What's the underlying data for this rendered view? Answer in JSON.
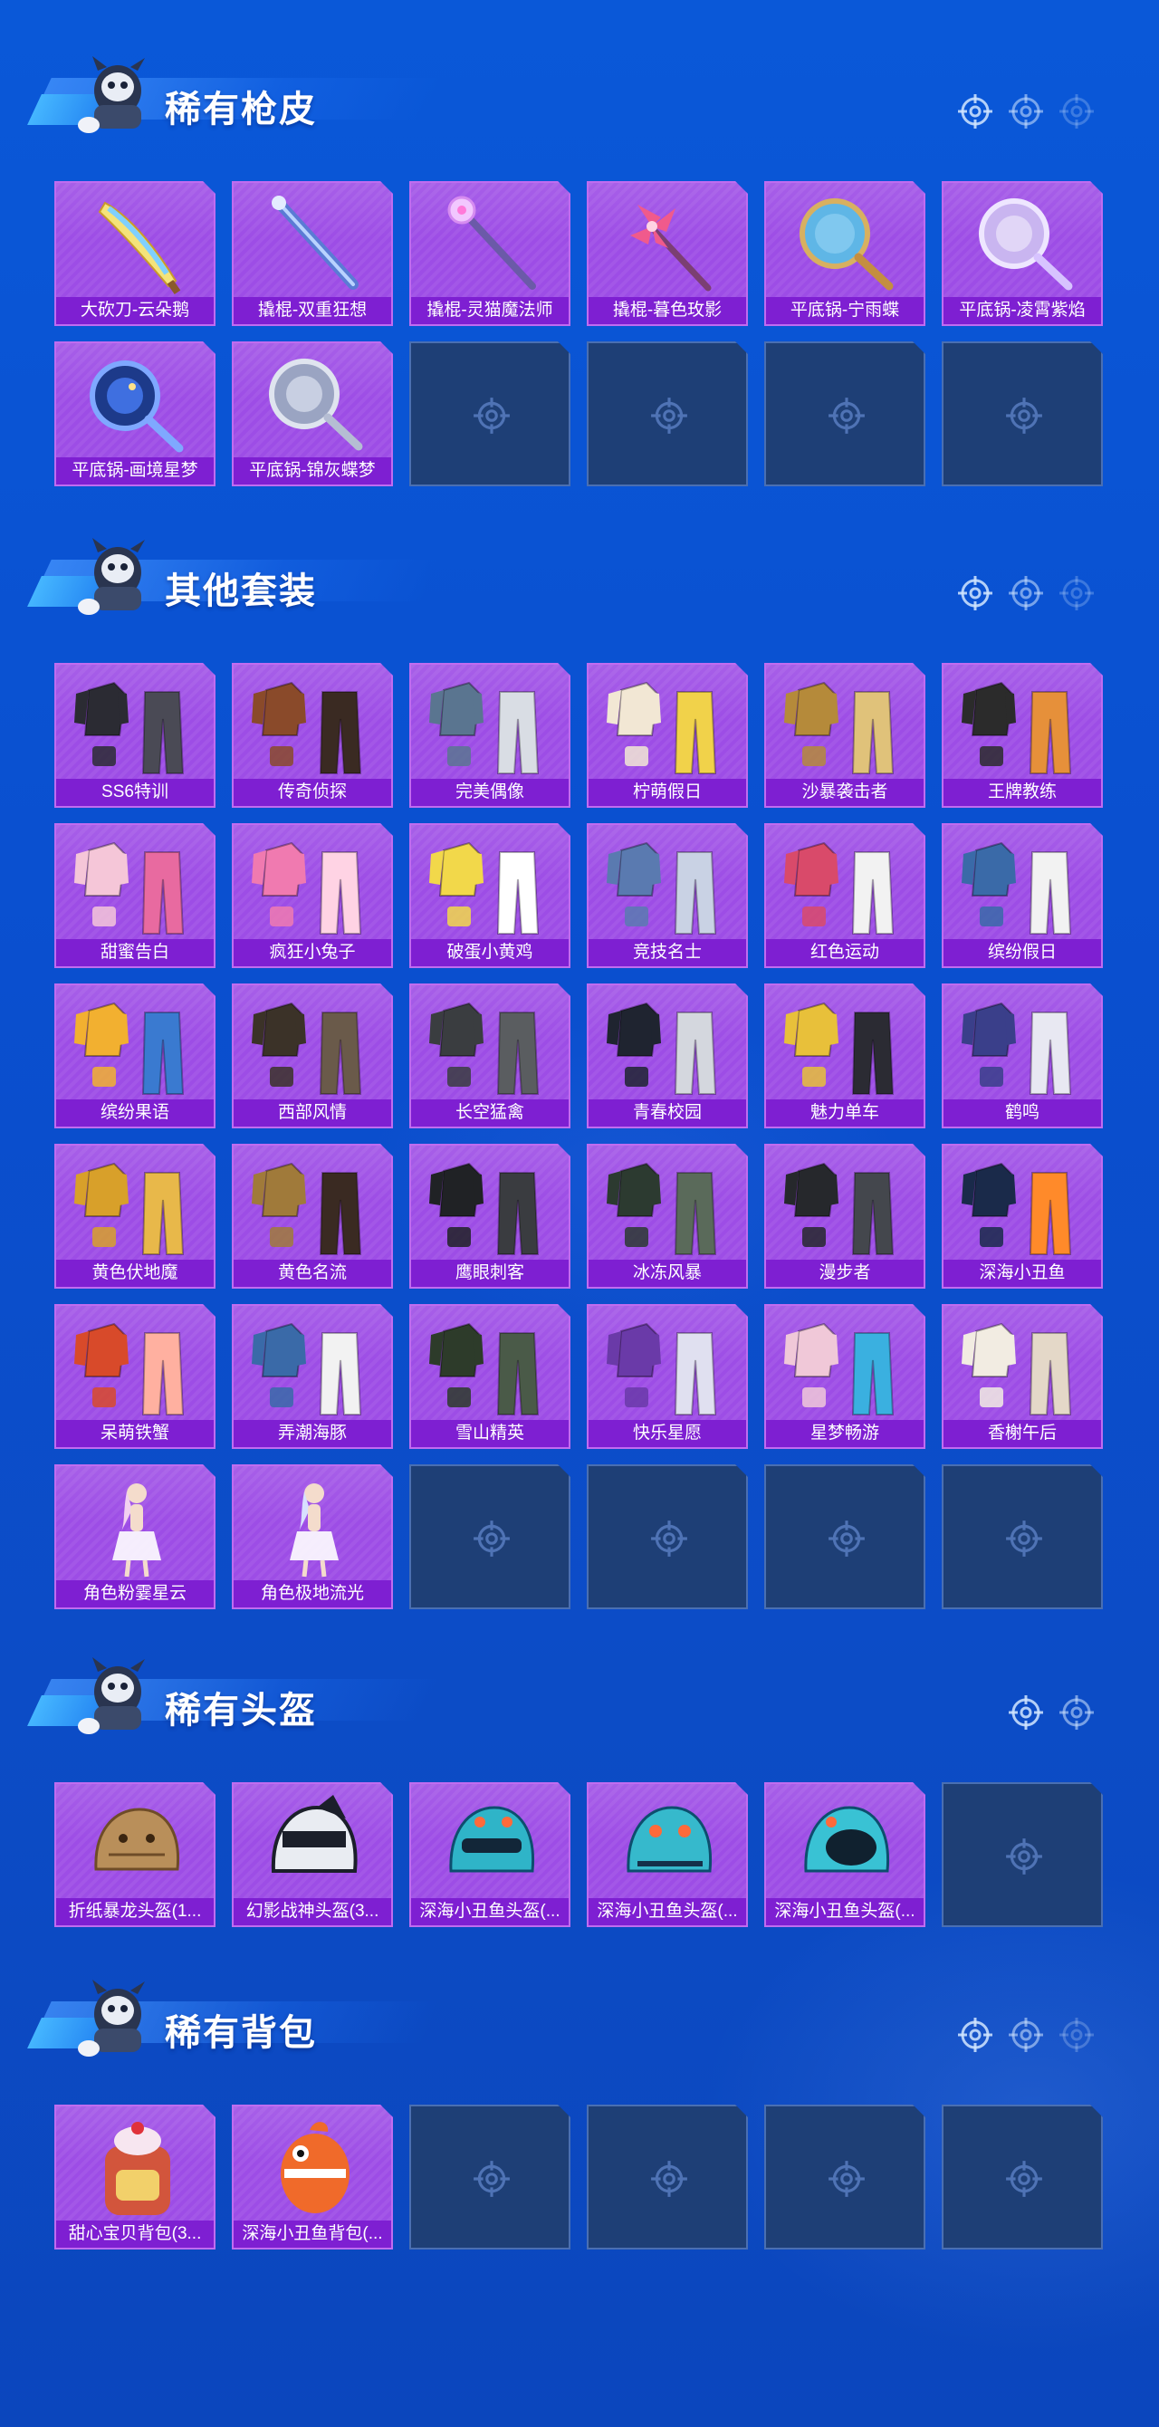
{
  "sections": [
    {
      "title": "稀有枪皮",
      "items": [
        {
          "label": "大砍刀-云朵鹅",
          "icon": "machete-icon"
        },
        {
          "label": "撬棍-双重狂想",
          "icon": "crowbar-icon"
        },
        {
          "label": "撬棍-灵猫魔法师",
          "icon": "crowbar-icon"
        },
        {
          "label": "撬棍-暮色玫影",
          "icon": "crowbar-icon"
        },
        {
          "label": "平底锅-宁雨蝶",
          "icon": "frying-pan-icon"
        },
        {
          "label": "平底锅-凌霄紫焰",
          "icon": "frying-pan-icon"
        },
        {
          "label": "平底锅-画境星梦",
          "icon": "frying-pan-icon"
        },
        {
          "label": "平底锅-锦灰蝶梦",
          "icon": "frying-pan-icon"
        }
      ]
    },
    {
      "title": "其他套装",
      "items": [
        {
          "label": "SS6特训",
          "icon": "outfit-icon"
        },
        {
          "label": "传奇侦探",
          "icon": "outfit-icon"
        },
        {
          "label": "完美偶像",
          "icon": "outfit-icon"
        },
        {
          "label": "柠萌假日",
          "icon": "outfit-icon"
        },
        {
          "label": "沙暴袭击者",
          "icon": "outfit-icon"
        },
        {
          "label": "王牌教练",
          "icon": "outfit-icon"
        },
        {
          "label": "甜蜜告白",
          "icon": "outfit-icon"
        },
        {
          "label": "疯狂小兔子",
          "icon": "outfit-icon"
        },
        {
          "label": "破蛋小黄鸡",
          "icon": "outfit-icon"
        },
        {
          "label": "竞技名士",
          "icon": "outfit-icon"
        },
        {
          "label": "红色运动",
          "icon": "outfit-icon"
        },
        {
          "label": "缤纷假日",
          "icon": "outfit-icon"
        },
        {
          "label": "缤纷果语",
          "icon": "outfit-icon"
        },
        {
          "label": "西部风情",
          "icon": "outfit-icon"
        },
        {
          "label": "长空猛禽",
          "icon": "outfit-icon"
        },
        {
          "label": "青春校园",
          "icon": "outfit-icon"
        },
        {
          "label": "魅力单车",
          "icon": "outfit-icon"
        },
        {
          "label": "鹤鸣",
          "icon": "outfit-icon"
        },
        {
          "label": "黄色伏地魔",
          "icon": "outfit-icon"
        },
        {
          "label": "黄色名流",
          "icon": "outfit-icon"
        },
        {
          "label": "鹰眼刺客",
          "icon": "outfit-icon"
        },
        {
          "label": "冰冻风暴",
          "icon": "outfit-icon"
        },
        {
          "label": "漫步者",
          "icon": "outfit-icon"
        },
        {
          "label": "深海小丑鱼",
          "icon": "outfit-icon"
        },
        {
          "label": "呆萌铁蟹",
          "icon": "outfit-icon"
        },
        {
          "label": "弄潮海豚",
          "icon": "outfit-icon"
        },
        {
          "label": "雪山精英",
          "icon": "outfit-icon"
        },
        {
          "label": "快乐星愿",
          "icon": "outfit-icon"
        },
        {
          "label": "星梦畅游",
          "icon": "outfit-icon"
        },
        {
          "label": "香榭午后",
          "icon": "outfit-icon"
        },
        {
          "label": "角色粉霎星云",
          "icon": "character-icon"
        },
        {
          "label": "角色极地流光",
          "icon": "character-icon"
        }
      ]
    },
    {
      "title": "稀有头盔",
      "items": [
        {
          "label": "折纸暴龙头盔(1...",
          "icon": "helmet-icon"
        },
        {
          "label": "幻影战神头盔(3...",
          "icon": "helmet-icon"
        },
        {
          "label": "深海小丑鱼头盔(...",
          "icon": "helmet-icon"
        },
        {
          "label": "深海小丑鱼头盔(...",
          "icon": "helmet-icon"
        },
        {
          "label": "深海小丑鱼头盔(...",
          "icon": "helmet-icon"
        }
      ]
    },
    {
      "title": "稀有背包",
      "items": [
        {
          "label": "甜心宝贝背包(3...",
          "icon": "backpack-icon"
        },
        {
          "label": "深海小丑鱼背包(...",
          "icon": "backpack-icon"
        }
      ]
    }
  ],
  "colors": {
    "background": "#0a52d2",
    "card": "#9d4de6",
    "card_label": "#7e1fd2",
    "empty_slot": "#1e3f76"
  }
}
